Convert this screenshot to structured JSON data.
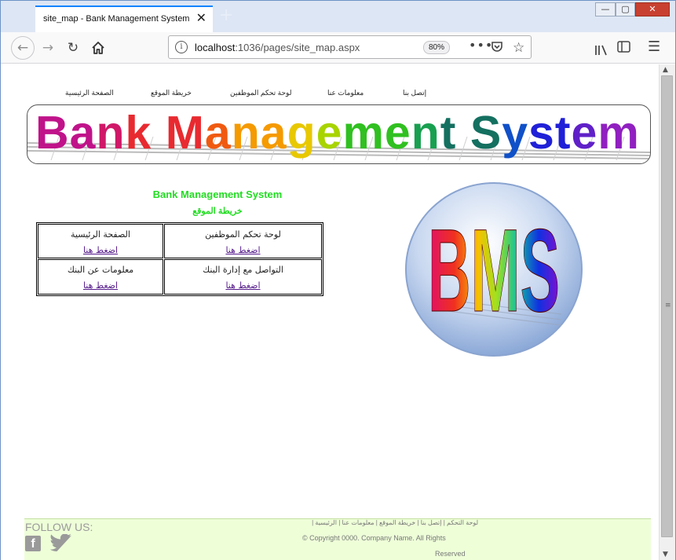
{
  "browser": {
    "tab_title": "site_map - Bank Management System",
    "tab_close": "✕",
    "new_tab": "+",
    "url_host": "localhost",
    "url_path": ":1036/pages/site_map.aspx",
    "zoom": "80%",
    "window_controls": {
      "minimize": "—",
      "maximize": "▢",
      "close": "✕"
    },
    "icons": [
      "back-arrow-icon",
      "forward-arrow-icon",
      "reload-icon",
      "home-icon",
      "info-icon",
      "more-icon",
      "pocket-icon",
      "bookmark-star-icon",
      "library-icon",
      "sidebar-icon",
      "hamburger-menu-icon"
    ]
  },
  "top_menu": {
    "contact": "إتصل بنا",
    "about": "معلومات عنا",
    "dashboard": "لوحة تحكم الموظفين",
    "site_map": "خريطة الموقع",
    "home": "الصفحة الرئيسية"
  },
  "banner": {
    "text": "Bank Management System",
    "colors": [
      "#c0138a",
      "#d01868",
      "#e82a30",
      "#f05a10",
      "#f59a00",
      "#e8c800",
      "#a8d400",
      "#30c020",
      "#18a050",
      "#147060",
      "#1050c8",
      "#2020d8",
      "#6020c8",
      "#9020c0"
    ]
  },
  "content": {
    "title": "Bank Management System",
    "subtitle": "خريطة الموقع",
    "cells": [
      {
        "label": "لوحة تحكم الموظفين",
        "link": "اضغط هنا"
      },
      {
        "label": "الصفحة الرئيسية",
        "link": "اضغط هنا"
      },
      {
        "label": "التواصل مع إدارة البنك",
        "link": "اضغط هنا"
      },
      {
        "label": "معلومات عن البنك",
        "link": "اضغط هنا"
      }
    ],
    "logo_text": "BMS"
  },
  "footer": {
    "follow": "FOLLOW US:",
    "facebook_letter": "f",
    "links": "لوحة التحكم | إتصل بنا | خريطة الموقع | معلومات عنا | الرئيسية |",
    "copyright": "© Copyright 0000. Company Name. All Rights",
    "reserved": "Reserved"
  }
}
